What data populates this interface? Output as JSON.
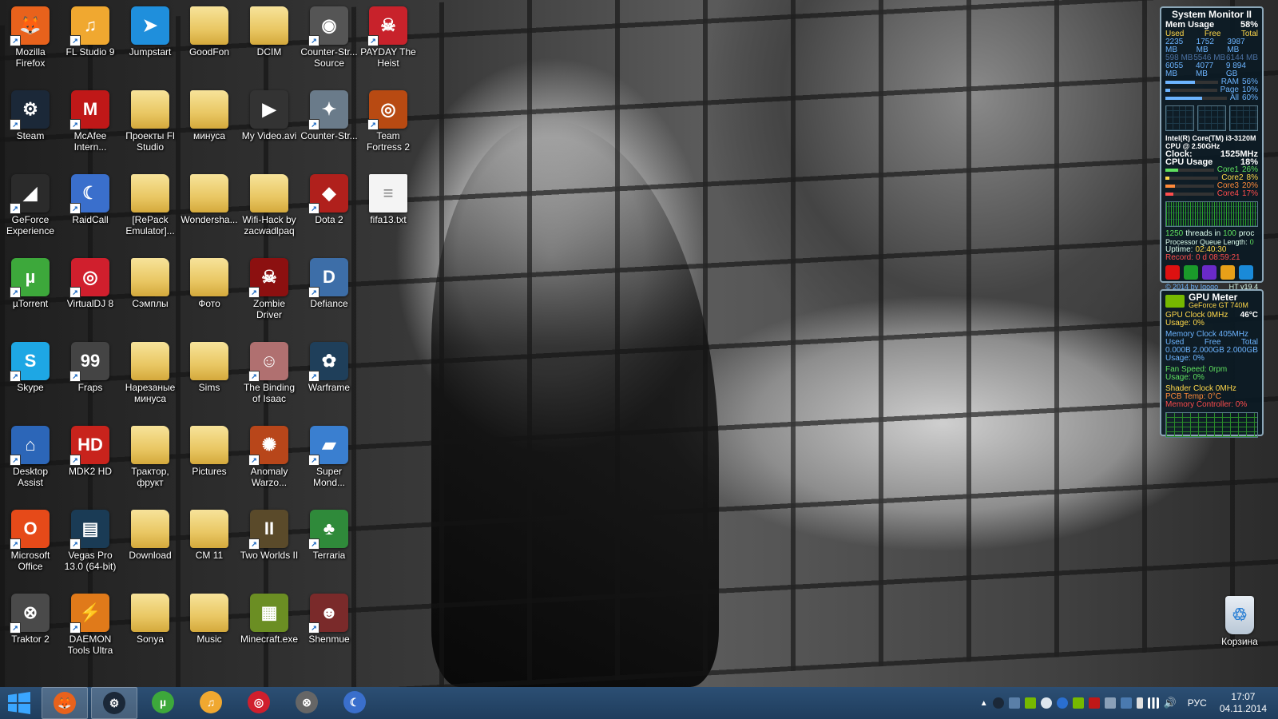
{
  "desktop": {
    "icons": [
      {
        "label": "Mozilla Firefox",
        "color": "#e8621c",
        "glyph": "🦊",
        "shortcut": true
      },
      {
        "label": "FL Studio 9",
        "color": "#f0a830",
        "glyph": "♫",
        "shortcut": true
      },
      {
        "label": "Jumpstart",
        "color": "#1f8fdc",
        "glyph": "➤",
        "shortcut": false
      },
      {
        "label": "GoodFon",
        "type": "folder",
        "shortcut": false
      },
      {
        "label": "DCIM",
        "type": "folder",
        "shortcut": false
      },
      {
        "label": "Counter-Str... Source",
        "color": "#555555",
        "glyph": "◉",
        "shortcut": true
      },
      {
        "label": "PAYDAY The Heist",
        "color": "#c8222b",
        "glyph": "☠",
        "shortcut": true
      },
      {
        "label": "Steam",
        "color": "#1b2838",
        "glyph": "⚙",
        "shortcut": true
      },
      {
        "label": "McAfee Intern...",
        "color": "#c01818",
        "glyph": "M",
        "shortcut": true
      },
      {
        "label": "Проекты Fl Studio",
        "type": "folder",
        "shortcut": false
      },
      {
        "label": "минуса",
        "type": "folder",
        "shortcut": false
      },
      {
        "label": "My Video.avi",
        "color": "#333333",
        "glyph": "▶",
        "shortcut": false
      },
      {
        "label": "Counter-Str...",
        "color": "#6a7b8a",
        "glyph": "✦",
        "shortcut": true
      },
      {
        "label": "Team Fortress 2",
        "color": "#b84a12",
        "glyph": "◎",
        "shortcut": true
      },
      {
        "label": "GeForce Experience",
        "color": "#2b2b2b",
        "glyph": "◢",
        "shortcut": true
      },
      {
        "label": "RaidCall",
        "color": "#3a6fcc",
        "glyph": "☾",
        "shortcut": true
      },
      {
        "label": "[RePack Emulator]...",
        "type": "folder",
        "shortcut": false
      },
      {
        "label": "Wondersha...",
        "type": "folder",
        "shortcut": false
      },
      {
        "label": "Wifi-Hack by zacwadlpaq",
        "type": "folder",
        "shortcut": false
      },
      {
        "label": "Dota 2",
        "color": "#b0201c",
        "glyph": "◆",
        "shortcut": true
      },
      {
        "label": "fifa13.txt",
        "type": "file",
        "glyph": "≡",
        "shortcut": false
      },
      {
        "label": "µTorrent",
        "color": "#3da83b",
        "glyph": "µ",
        "shortcut": true
      },
      {
        "label": "VirtualDJ 8",
        "color": "#d01f2d",
        "glyph": "◎",
        "shortcut": true
      },
      {
        "label": "Сэмплы",
        "type": "folder",
        "shortcut": false
      },
      {
        "label": "Фото",
        "type": "folder",
        "shortcut": false
      },
      {
        "label": "Zombie Driver",
        "color": "#8c1010",
        "glyph": "☠",
        "shortcut": true
      },
      {
        "label": "Defiance",
        "color": "#3d6ea8",
        "glyph": "D",
        "shortcut": true
      },
      {
        "label": "Skype",
        "color": "#1ea7e4",
        "glyph": "S",
        "shortcut": true
      },
      {
        "label": "Fraps",
        "color": "#444444",
        "glyph": "99",
        "shortcut": true
      },
      {
        "label": "Нарезаные минуса",
        "type": "folder",
        "shortcut": false
      },
      {
        "label": "Sims",
        "type": "folder",
        "shortcut": false
      },
      {
        "label": "The Binding of Isaac",
        "color": "#b07070",
        "glyph": "☺",
        "shortcut": true
      },
      {
        "label": "Warframe",
        "color": "#1f3f5a",
        "glyph": "✿",
        "shortcut": true
      },
      {
        "label": "Desktop Assist",
        "color": "#2c66b8",
        "glyph": "⌂",
        "shortcut": true
      },
      {
        "label": "MDK2 HD",
        "color": "#c8231c",
        "glyph": "HD",
        "shortcut": true
      },
      {
        "label": "Трактор, фрукт",
        "type": "folder",
        "shortcut": false
      },
      {
        "label": "Pictures",
        "type": "folder",
        "shortcut": false
      },
      {
        "label": "Anomaly Warzo...",
        "color": "#b8461a",
        "glyph": "✺",
        "shortcut": true
      },
      {
        "label": "Super Mond...",
        "color": "#3a7fd0",
        "glyph": "▰",
        "shortcut": true
      },
      {
        "label": "Microsoft Office",
        "color": "#e64a19",
        "glyph": "O",
        "shortcut": true
      },
      {
        "label": "Vegas Pro 13.0 (64-bit)",
        "color": "#1a3b55",
        "glyph": "▤",
        "shortcut": true
      },
      {
        "label": "Download",
        "type": "folder",
        "shortcut": false
      },
      {
        "label": "CM 11",
        "type": "folder",
        "shortcut": false
      },
      {
        "label": "Two Worlds II",
        "color": "#5a4a2a",
        "glyph": "II",
        "shortcut": true
      },
      {
        "label": "Terraria",
        "color": "#2f8a3a",
        "glyph": "♣",
        "shortcut": true
      },
      {
        "label": "Traktor 2",
        "color": "#4a4a4a",
        "glyph": "⊗",
        "shortcut": true
      },
      {
        "label": "DAEMON Tools Ultra",
        "color": "#e07a1a",
        "glyph": "⚡",
        "shortcut": true
      },
      {
        "label": "Sonya",
        "type": "folder",
        "shortcut": false
      },
      {
        "label": "Music",
        "type": "folder",
        "shortcut": false
      },
      {
        "label": "Minecraft.exe",
        "color": "#6b8e23",
        "glyph": "▦",
        "shortcut": false
      },
      {
        "label": "Shenmue",
        "color": "#7a2a2a",
        "glyph": "☻",
        "shortcut": true
      }
    ],
    "recycle_bin": {
      "label": "Корзина",
      "glyph": "♲"
    }
  },
  "system_monitor": {
    "title": "System Monitor II",
    "mem_label": "Mem Usage",
    "mem_percent": "58%",
    "mem_headers": [
      "Used",
      "Free",
      "Total"
    ],
    "mem_rows": [
      [
        "2235 MB",
        "1752 MB",
        "3987 MB"
      ],
      [
        "598 MB",
        "5546 MB",
        "6144 MB"
      ],
      [
        "6055 MB",
        "4077 MB",
        "9 894 GB"
      ]
    ],
    "bars": [
      {
        "label": "RAM",
        "value": "56%",
        "fill": 0.56
      },
      {
        "label": "Page",
        "value": "10%",
        "fill": 0.1
      },
      {
        "label": "All",
        "value": "60%",
        "fill": 0.6
      }
    ],
    "cpu_name": "Intel(R) Core(TM) i3-3120M",
    "cpu_freq": "CPU @ 2.50GHz",
    "clock_label": "Clock:",
    "clock_value": "1525MHz",
    "cpu_label": "CPU Usage",
    "cpu_percent": "18%",
    "cores": [
      {
        "label": "Core1",
        "value": "26%",
        "fill": 0.26
      },
      {
        "label": "Core2",
        "value": "8%",
        "fill": 0.08
      },
      {
        "label": "Core3",
        "value": "20%",
        "fill": 0.2
      },
      {
        "label": "Core4",
        "value": "17%",
        "fill": 0.17
      }
    ],
    "threads_count": "1250",
    "threads_text": "threads in",
    "proc_count": "100",
    "proc_text": "proc",
    "queue": "Processor Queue Length:",
    "queue_value": "0",
    "uptime_label": "Uptime:",
    "uptime_value": "02:40:30",
    "record_label": "Record:",
    "record_value": "0 d 08:59:21",
    "footer": "© 2014 by Igogo",
    "version": "HT v19.4"
  },
  "gpu_meter": {
    "title": "GPU Meter",
    "model": "GeForce GT 740M",
    "gpu_clock": "GPU Clock 0MHz",
    "temp": "46°C",
    "usage1": "Usage: 0%",
    "mem_clock": "Memory Clock 405MHz",
    "headers": [
      "Used",
      "Free",
      "Total"
    ],
    "mem_values": [
      "0.000B",
      "2.000GB",
      "2.000GB"
    ],
    "usage2": "Usage: 0%",
    "fan": "Fan Speed: 0rpm",
    "usage3": "Usage: 0%",
    "shader": "Shader Clock 0MHz",
    "pcb": "PCB Temp: 0°C",
    "mem_ctrl": "Memory Controller: 0%"
  },
  "taskbar": {
    "apps": [
      {
        "name": "firefox",
        "color": "#e8621c",
        "glyph": "🦊",
        "active": true
      },
      {
        "name": "steam",
        "color": "#1b2838",
        "glyph": "⚙",
        "active": true
      },
      {
        "name": "utorrent",
        "color": "#3da83b",
        "glyph": "µ",
        "active": false
      },
      {
        "name": "fl-studio",
        "color": "#f0a830",
        "glyph": "♫",
        "active": false
      },
      {
        "name": "virtualdj",
        "color": "#d01f2d",
        "glyph": "◎",
        "active": false
      },
      {
        "name": "traktor",
        "color": "#666666",
        "glyph": "⊗",
        "active": false
      },
      {
        "name": "raidcall",
        "color": "#3a6fcc",
        "glyph": "☾",
        "active": false
      }
    ],
    "language": "РУС",
    "time": "17:07",
    "date": "04.11.2014"
  }
}
